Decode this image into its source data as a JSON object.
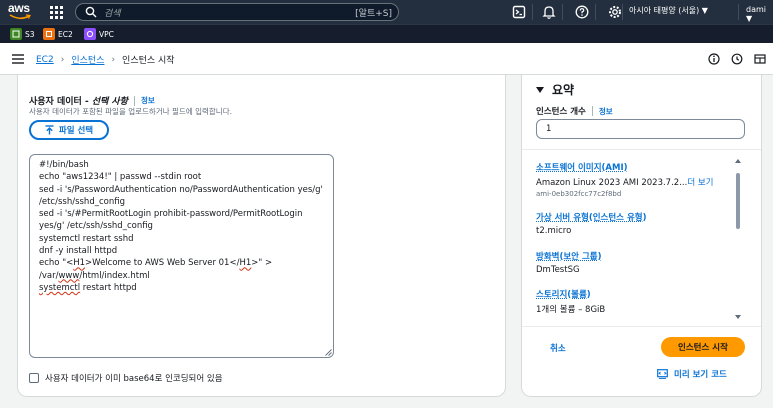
{
  "topbar": {
    "logo_text": "aws",
    "search_placeholder": "검색",
    "search_shortcut": "[알트+S]",
    "region": "아시아 태평양 (서울) ▼",
    "user": "dami ▼"
  },
  "favorites": [
    {
      "label": "S3",
      "color": "#3f8624"
    },
    {
      "label": "EC2",
      "color": "#ec7211"
    },
    {
      "label": "VPC",
      "color": "#8c4fff"
    }
  ],
  "breadcrumb": {
    "items": [
      "EC2",
      "인스턴스"
    ],
    "current": "인스턴스 시작"
  },
  "user_data": {
    "title": "사용자 데이터 -",
    "title_optional": "선택 사항",
    "info": "정보",
    "description": "사용자 데이터가 포함된 파일을 업로드하거나 필드에 입력합니다.",
    "file_button": "파일 선택",
    "script_lines": [
      "#!/bin/bash",
      "echo \"aws1234!\" | passwd --stdin root",
      "sed -i 's/PasswordAuthentication no/PasswordAuthentication yes/g'",
      "/etc/ssh/sshd_config",
      "sed -i 's/#PermitRootLogin prohibit-password/PermitRootLogin",
      "yes/g' /etc/ssh/sshd_config",
      "systemctl restart sshd",
      "dnf -y install httpd",
      "echo \"<H1>Welcome to AWS Web Server 01</H1>\" >",
      "/var/www/html/index.html",
      "systemctl restart httpd"
    ],
    "base64_checkbox": "사용자 데이터가 이미 base64로 인코딩되어 있음"
  },
  "summary": {
    "title": "요약",
    "count_label": "인스턴스 개수",
    "count_info": "정보",
    "count_value": "1",
    "items": [
      {
        "key": "소프트웨어 이미지(AMI)",
        "value": "Amazon Linux 2023 AMI 2023.7.2...",
        "more": "더 보기",
        "sub": "ami-0eb302fcc77c2f8bd"
      },
      {
        "key": "가상 서버 유형(인스턴스 유형)",
        "value": "t2.micro"
      },
      {
        "key": "방화벽(보안 그룹)",
        "value": "DmTestSG"
      },
      {
        "key": "스토리지(볼륨)",
        "value": "1개의 볼륨 – 8GiB"
      }
    ],
    "cancel": "취소",
    "launch": "인스턴스 시작",
    "preview": "미리 보기 코드"
  }
}
